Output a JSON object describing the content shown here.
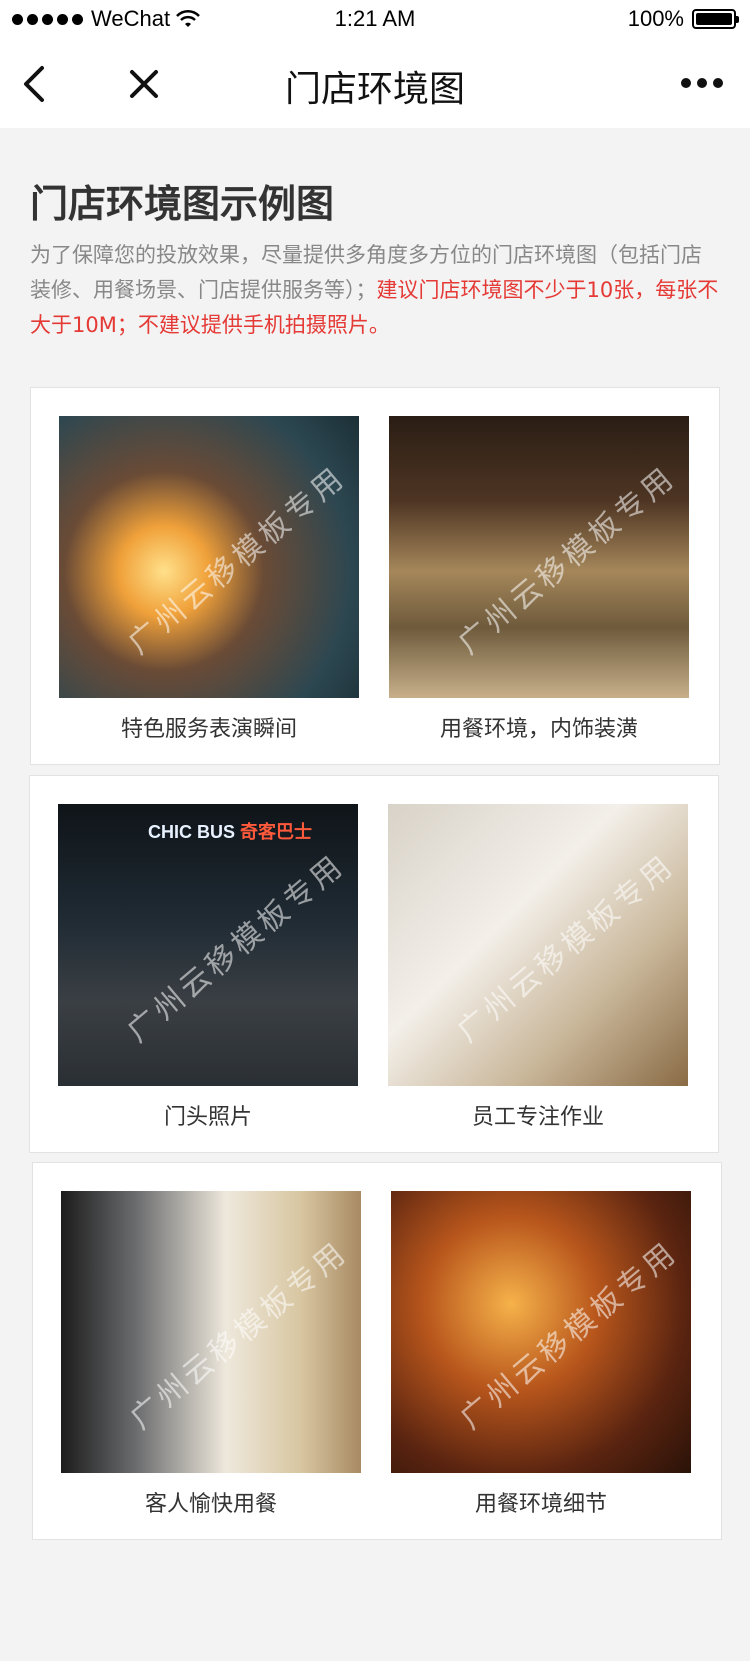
{
  "status_bar": {
    "carrier": "WeChat",
    "time": "1:21 AM",
    "battery": "100%"
  },
  "nav": {
    "title": "门店环境图"
  },
  "intro": {
    "title": "门店环境图示例图",
    "desc_normal": "为了保障您的投放效果，尽量提供多角度多方位的门店环境图（包括门店装修、用餐场景、门店提供服务等）；",
    "desc_warning": "建议门店环境图不少于10张，每张不大于10M；不建议提供手机拍摄照片。"
  },
  "gallery": {
    "items": [
      {
        "caption": "特色服务表演瞬间"
      },
      {
        "caption": "用餐环境，内饰装潢"
      },
      {
        "caption": "门头照片",
        "sign_en": "CHIC BUS",
        "sign_cn": "奇客巴士"
      },
      {
        "caption": "员工专注作业"
      },
      {
        "caption": "客人愉快用餐"
      },
      {
        "caption": "用餐环境细节"
      }
    ],
    "watermark": "广州云移模板专用"
  },
  "colors": {
    "warning": "#e53935",
    "background": "#f3f3f3"
  }
}
